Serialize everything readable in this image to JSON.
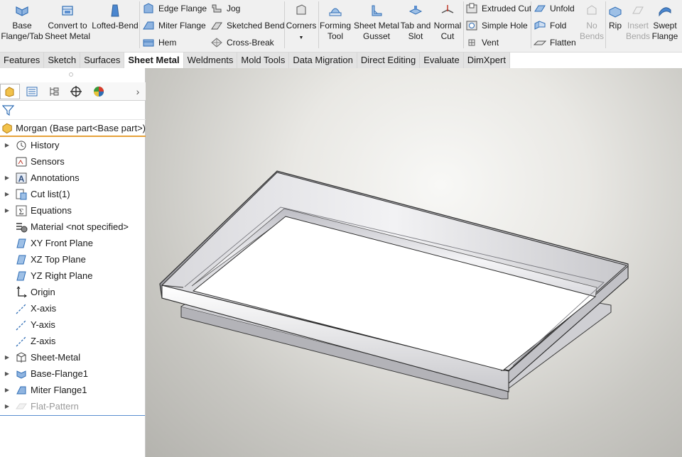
{
  "ribbon": {
    "base_flange": "Base\nFlange/Tab",
    "convert": "Convert to\nSheet Metal",
    "lofted": "Lofted-Bend",
    "edge_flange": "Edge Flange",
    "miter_flange": "Miter Flange",
    "hem": "Hem",
    "jog": "Jog",
    "sketched_bend": "Sketched Bend",
    "cross_break": "Cross-Break",
    "corners": "Corners",
    "forming_tool": "Forming\nTool",
    "gusset": "Sheet Metal\nGusset",
    "tab_slot": "Tab and\nSlot",
    "normal_cut": "Normal\nCut",
    "extruded_cut": "Extruded Cut",
    "simple_hole": "Simple Hole",
    "vent": "Vent",
    "unfold": "Unfold",
    "fold": "Fold",
    "flatten": "Flatten",
    "no_bends": "No\nBends",
    "rip": "Rip",
    "insert_bends": "Insert\nBends",
    "swept_flange": "Swept\nFlange"
  },
  "tabs": [
    "Features",
    "Sketch",
    "Surfaces",
    "Sheet Metal",
    "Weldments",
    "Mold Tools",
    "Data Migration",
    "Direct Editing",
    "Evaluate",
    "DimXpert"
  ],
  "active_tab": "Sheet Metal",
  "tree": {
    "root": "Morgan  (Base part<Base part>)",
    "items": [
      {
        "label": "History",
        "expandable": true,
        "icon": "history-icon"
      },
      {
        "label": "Sensors",
        "expandable": false,
        "icon": "sensor-icon"
      },
      {
        "label": "Annotations",
        "expandable": true,
        "icon": "annotations-icon"
      },
      {
        "label": "Cut list(1)",
        "expandable": true,
        "icon": "cut-list-icon"
      },
      {
        "label": "Equations",
        "expandable": true,
        "icon": "equations-icon"
      },
      {
        "label": "Material <not specified>",
        "expandable": false,
        "icon": "material-icon"
      },
      {
        "label": "XY Front Plane",
        "expandable": false,
        "icon": "plane-icon"
      },
      {
        "label": "XZ Top Plane",
        "expandable": false,
        "icon": "plane-icon"
      },
      {
        "label": "YZ Right Plane",
        "expandable": false,
        "icon": "plane-icon"
      },
      {
        "label": "Origin",
        "expandable": false,
        "icon": "origin-icon"
      },
      {
        "label": "X-axis",
        "expandable": false,
        "icon": "axis-icon"
      },
      {
        "label": "Y-axis",
        "expandable": false,
        "icon": "axis-icon"
      },
      {
        "label": "Z-axis",
        "expandable": false,
        "icon": "axis-icon"
      },
      {
        "label": "Sheet-Metal",
        "expandable": true,
        "icon": "sheet-metal-icon"
      },
      {
        "label": "Base-Flange1",
        "expandable": true,
        "icon": "base-flange-icon"
      },
      {
        "label": "Miter Flange1",
        "expandable": true,
        "icon": "miter-flange-icon"
      },
      {
        "label": "Flat-Pattern",
        "expandable": true,
        "icon": "flat-pattern-icon",
        "suppressed": true
      }
    ]
  },
  "colors": {
    "accent": "#e6a13a",
    "icon_blue": "#2f6db5",
    "selection": "#5a8fd0"
  }
}
